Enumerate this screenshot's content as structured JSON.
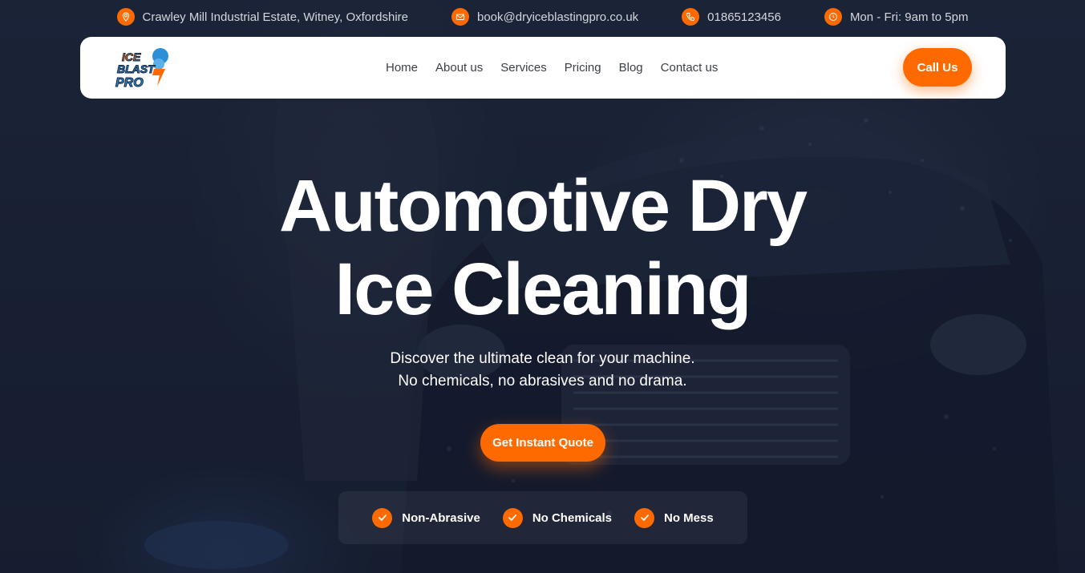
{
  "topbar": {
    "address": "Crawley Mill Industrial Estate, Witney, Oxfordshire",
    "email": "book@dryiceblastingpro.co.uk",
    "phone": "01865123456",
    "hours": "Mon - Fri: 9am to 5pm",
    "icons": [
      "location-pin-icon",
      "mail-icon",
      "phone-icon",
      "clock-icon"
    ]
  },
  "nav": {
    "logo_text": [
      "ICE",
      "BLAST",
      "PRO"
    ],
    "links": [
      "Home",
      "About us",
      "Services",
      "Pricing",
      "Blog",
      "Contact us"
    ],
    "call_label": "Call Us"
  },
  "hero": {
    "title_line1": "Automotive Dry",
    "title_line2": "Ice Cleaning",
    "subtitle_line1": "Discover the ultimate clean for your machine.",
    "subtitle_line2": "No chemicals, no abrasives and no drama.",
    "cta_label": "Get Instant Quote"
  },
  "features": [
    "Non-Abrasive",
    "No Chemicals",
    "No Mess"
  ],
  "colors": {
    "accent": "#ff6a00",
    "background": "#1a2235",
    "nav_text": "#3c3f46"
  }
}
